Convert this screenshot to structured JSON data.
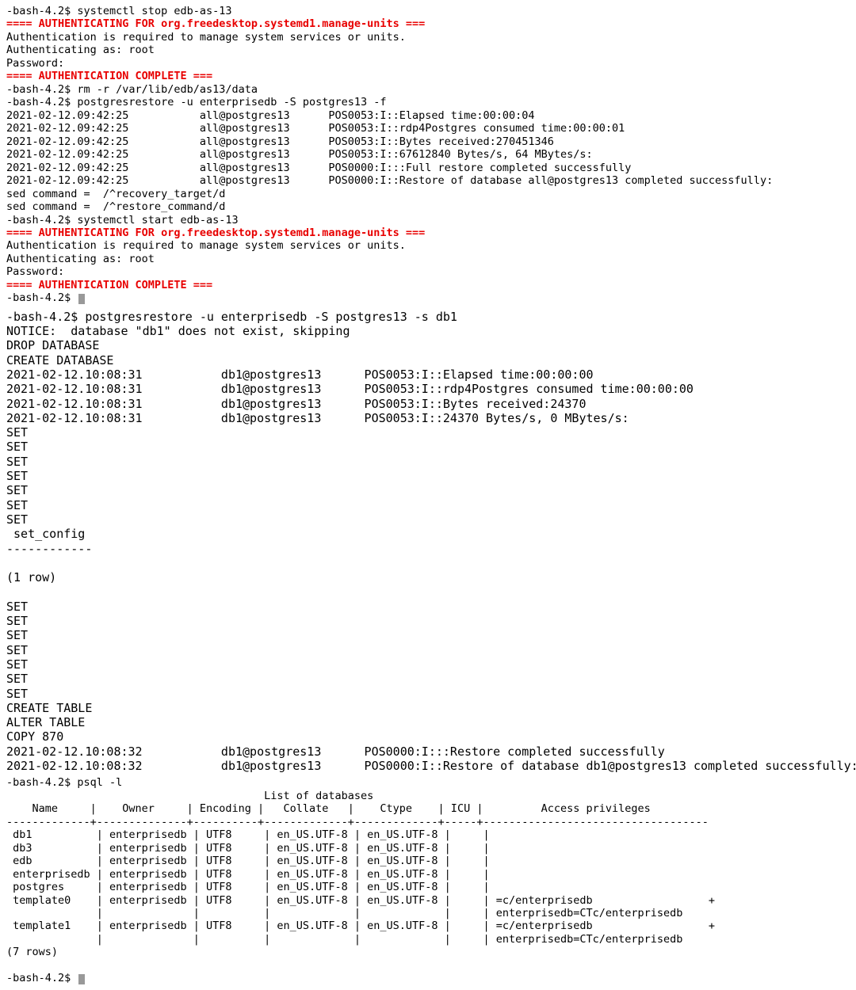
{
  "block1": {
    "prompt": "-bash-4.2$ ",
    "cmd_stop": "systemctl stop edb-as-13",
    "auth_for": "==== AUTHENTICATING FOR org.freedesktop.systemd1.manage-units ===",
    "auth_req": "Authentication is required to manage system services or units.",
    "auth_as": "Authenticating as: root",
    "password": "Password:",
    "auth_complete": "==== AUTHENTICATION COMPLETE ===",
    "cmd_rm": "rm -r /var/lib/edb/as13/data",
    "cmd_restore": "postgresrestore -u enterprisedb -S postgres13 -f",
    "log_ts": "2021-02-12.09:42:25",
    "log_target": "all@postgres13",
    "log_lines": [
      "POS0053:I::Elapsed time:00:00:04",
      "POS0053:I::rdp4Postgres consumed time:00:00:01",
      "POS0053:I::Bytes received:270451346",
      "POS0053:I::67612840 Bytes/s, 64 MBytes/s:",
      "POS0000:I:::Full restore completed successfully",
      "POS0000:I::Restore of database all@postgres13 completed successfully:"
    ],
    "sed1": "sed command =  /^recovery_target/d",
    "sed2": "sed command =  /^restore_command/d",
    "cmd_start": "systemctl start edb-as-13",
    "final_prompt": "-bash-4.2$ "
  },
  "block2": {
    "prompt": "-bash-4.2$ ",
    "cmd_restore": "postgresrestore -u enterprisedb -S postgres13 -s db1",
    "notice": "NOTICE:  database \"db1\" does not exist, skipping",
    "drop": "DROP DATABASE",
    "create": "CREATE DATABASE",
    "log_ts": "2021-02-12.10:08:31",
    "log_target": "db1@postgres13",
    "log_lines": [
      "POS0053:I::Elapsed time:00:00:00",
      "POS0053:I::rdp4Postgres consumed time:00:00:00",
      "POS0053:I::Bytes received:24370",
      "POS0053:I::24370 Bytes/s, 0 MBytes/s:"
    ],
    "set": "SET",
    "set_count1": 7,
    "set_config": " set_config ",
    "dashes": "------------",
    "one_row": "(1 row)",
    "set_count2": 7,
    "create_table": "CREATE TABLE",
    "alter_table": "ALTER TABLE",
    "copy": "COPY 870",
    "log_ts2": "2021-02-12.10:08:32",
    "end_lines": [
      "POS0000:I:::Restore completed successfully",
      "POS0000:I::Restore of database db1@postgres13 completed successfully:"
    ]
  },
  "block3": {
    "prompt": "-bash-4.2$ ",
    "cmd_psql": "psql -l",
    "title": "                                        List of databases",
    "header": "    Name     |    Owner     | Encoding |   Collate   |    Ctype    | ICU |         Access privileges         ",
    "hr": "-------------+--------------+----------+-------------+-------------+-----+-----------------------------------",
    "rows": [
      " db1          | enterprisedb | UTF8     | en_US.UTF-8 | en_US.UTF-8 |     | ",
      " db3          | enterprisedb | UTF8     | en_US.UTF-8 | en_US.UTF-8 |     | ",
      " edb          | enterprisedb | UTF8     | en_US.UTF-8 | en_US.UTF-8 |     | ",
      " enterprisedb | enterprisedb | UTF8     | en_US.UTF-8 | en_US.UTF-8 |     | ",
      " postgres     | enterprisedb | UTF8     | en_US.UTF-8 | en_US.UTF-8 |     | ",
      " template0    | enterprisedb | UTF8     | en_US.UTF-8 | en_US.UTF-8 |     | =c/enterprisedb                  +",
      "              |              |          |             |             |     | enterprisedb=CTc/enterprisedb",
      " template1    | enterprisedb | UTF8     | en_US.UTF-8 | en_US.UTF-8 |     | =c/enterprisedb                  +",
      "              |              |          |             |             |     | enterprisedb=CTc/enterprisedb"
    ],
    "count": "(7 rows)",
    "final_prompt": "-bash-4.2$ "
  }
}
